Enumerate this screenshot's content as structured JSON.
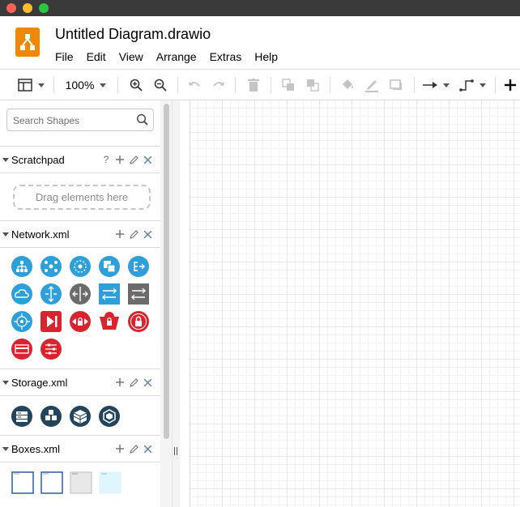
{
  "window": {
    "title": "Untitled Diagram.drawio"
  },
  "menu": [
    "File",
    "Edit",
    "View",
    "Arrange",
    "Extras",
    "Help"
  ],
  "toolbar": {
    "zoom": "100%"
  },
  "sidebar": {
    "search_placeholder": "Search Shapes",
    "scratchpad": {
      "title": "Scratchpad",
      "help": "?",
      "drop_hint": "Drag elements here"
    },
    "sections": [
      {
        "title": "Network.xml"
      },
      {
        "title": "Storage.xml"
      },
      {
        "title": "Boxes.xml"
      }
    ]
  },
  "colors": {
    "network_blue": "#2d9fd9",
    "network_gray": "#6b6b6b",
    "network_red": "#d9232e",
    "storage_navy": "#23445d",
    "drawio_orange": "#f08705"
  },
  "icons": {
    "network_shapes": [
      "hierarchy",
      "nodes",
      "hub",
      "copy",
      "list-arrow",
      "cloud",
      "arrows-vertical",
      "arrows-horizontal",
      "exchange",
      "exchange-gray",
      "target",
      "play",
      "lock-shield",
      "camera-lock",
      "padlock",
      "card",
      "sliders"
    ],
    "storage_shapes": [
      "server-rack",
      "cubes",
      "storage-box",
      "cube-outline"
    ],
    "box_shapes": [
      "outline-box",
      "outline-box-2",
      "gray-box",
      "light-blue-box"
    ]
  }
}
